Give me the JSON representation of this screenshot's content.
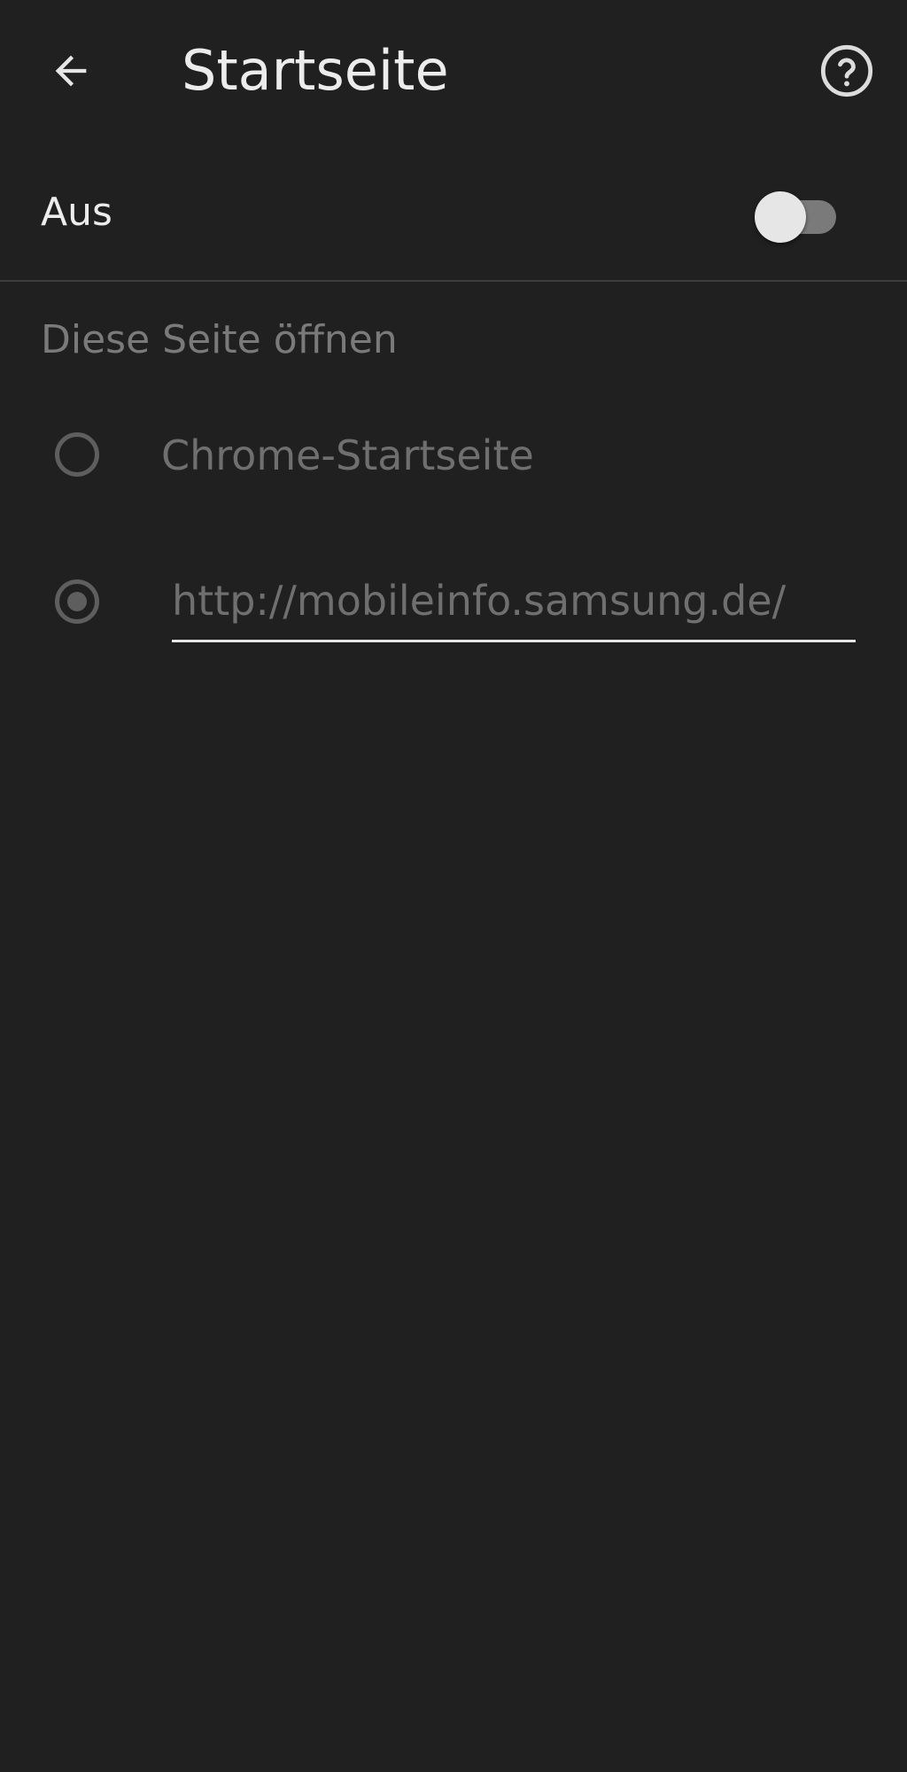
{
  "header": {
    "title": "Startseite",
    "back_icon": "arrow-left-icon",
    "help_icon": "help-circle-icon"
  },
  "master_switch": {
    "label": "Aus",
    "state": "off"
  },
  "section": {
    "header": "Diese Seite öffnen"
  },
  "options": {
    "chrome_home": {
      "label": "Chrome-Startseite",
      "selected": false
    },
    "custom_url": {
      "value": "http://mobileinfo.samsung.de/",
      "selected": true
    }
  },
  "colors": {
    "background": "#202020",
    "text_primary": "#ececec",
    "text_disabled": "#6f6f6f",
    "divider": "#3d3d3d"
  }
}
